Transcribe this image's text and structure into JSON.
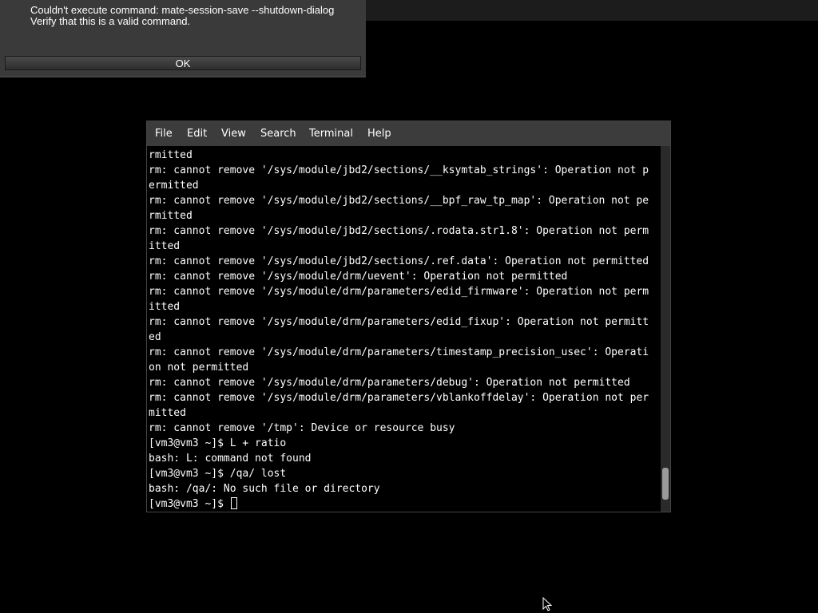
{
  "dialog": {
    "message_line1": "Couldn't execute command: mate-session-save --shutdown-dialog",
    "message_line2": "Verify that this is a valid command.",
    "ok_label": "OK"
  },
  "terminal": {
    "menu": [
      "File",
      "Edit",
      "View",
      "Search",
      "Terminal",
      "Help"
    ],
    "lines": [
      "rmitted",
      "rm: cannot remove '/sys/module/jbd2/sections/__ksymtab_strings': Operation not p",
      "ermitted",
      "rm: cannot remove '/sys/module/jbd2/sections/__bpf_raw_tp_map': Operation not pe",
      "rmitted",
      "rm: cannot remove '/sys/module/jbd2/sections/.rodata.str1.8': Operation not perm",
      "itted",
      "rm: cannot remove '/sys/module/jbd2/sections/.ref.data': Operation not permitted",
      "rm: cannot remove '/sys/module/drm/uevent': Operation not permitted",
      "rm: cannot remove '/sys/module/drm/parameters/edid_firmware': Operation not perm",
      "itted",
      "rm: cannot remove '/sys/module/drm/parameters/edid_fixup': Operation not permitt",
      "ed",
      "rm: cannot remove '/sys/module/drm/parameters/timestamp_precision_usec': Operati",
      "on not permitted",
      "rm: cannot remove '/sys/module/drm/parameters/debug': Operation not permitted",
      "rm: cannot remove '/sys/module/drm/parameters/vblankoffdelay': Operation not per",
      "mitted",
      "rm: cannot remove '/tmp': Device or resource busy",
      "[vm3@vm3 ~]$ L + ratio",
      "bash: L: command not found",
      "[vm3@vm3 ~]$ /qa/ lost",
      "bash: /qa/: No such file or directory"
    ],
    "prompt": "[vm3@vm3 ~]$ "
  },
  "colors": {
    "desktop_bg": "#000000",
    "menubar_bg": "#3c3c3c",
    "dialog_bg": "#3a3a3a",
    "text": "#ffffff"
  }
}
